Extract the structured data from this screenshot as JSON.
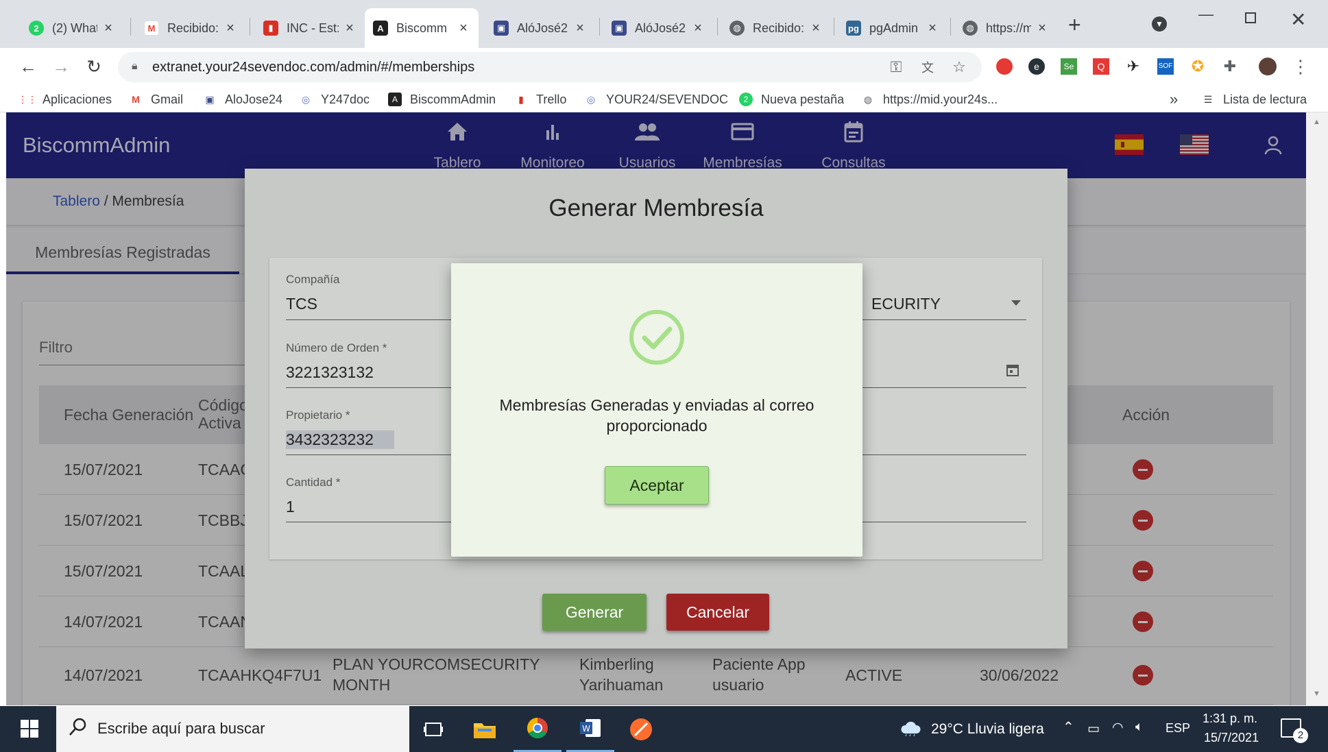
{
  "browser": {
    "tabs": [
      {
        "title": "(2) What:",
        "icon": "whatsapp-icon",
        "color": "#25d366"
      },
      {
        "title": "Recibido:",
        "icon": "gmail-icon",
        "color": "#ea4335"
      },
      {
        "title": "INC - Est:",
        "icon": "ticket-icon",
        "color": "#d93025"
      },
      {
        "title": "Biscomm",
        "icon": "angular-icon",
        "color": "#222222",
        "active": true
      },
      {
        "title": "AlóJosé2",
        "icon": "app-icon",
        "color": "#3a4a8a"
      },
      {
        "title": "AlóJosé2",
        "icon": "app-icon",
        "color": "#3a4a8a"
      },
      {
        "title": "Recibido:",
        "icon": "globe-icon",
        "color": "#5f6368"
      },
      {
        "title": "pgAdmin",
        "icon": "pgadmin-icon",
        "color": "#336791"
      },
      {
        "title": "https://m",
        "icon": "globe-icon",
        "color": "#5f6368"
      }
    ],
    "new_tab_label": "+",
    "url": "extranet.your24sevendoc.com/admin/#/memberships",
    "bookmarks": [
      {
        "label": "Aplicaciones",
        "icon": "apps-grid-icon"
      },
      {
        "label": "Gmail",
        "icon": "gmail-icon"
      },
      {
        "label": "AloJose24",
        "icon": "app-icon"
      },
      {
        "label": "Y247doc",
        "icon": "signal-icon"
      },
      {
        "label": "BiscommAdmin",
        "icon": "angular-icon"
      },
      {
        "label": "Trello",
        "icon": "trello-icon"
      },
      {
        "label": "YOUR24/SEVENDOC",
        "icon": "signal-icon"
      },
      {
        "label": "Nueva pestaña",
        "icon": "whatsapp-icon"
      },
      {
        "label": "https://mid.your24s...",
        "icon": "globe-icon"
      }
    ],
    "overflow_label": "»",
    "reading_list_label": "Lista de lectura"
  },
  "app": {
    "brand": "BiscommAdmin",
    "nav": [
      {
        "label": "Tablero",
        "icon": "home-icon"
      },
      {
        "label": "Monitoreo",
        "icon": "bar-chart-icon"
      },
      {
        "label": "Usuarios",
        "icon": "users-icon"
      },
      {
        "label": "Membresías",
        "icon": "credit-card-icon"
      },
      {
        "label": "Consultas",
        "icon": "calendar-icon"
      }
    ],
    "breadcrumb": {
      "root": "Tablero",
      "separator": " / ",
      "current": "Membresía"
    },
    "tab_label": "Membresías Registradas",
    "filter_placeholder": "Filtro",
    "table": {
      "headers": [
        "Fecha Generación",
        "Código\nActiva",
        "Acción"
      ],
      "rows": [
        {
          "fecha": "15/07/2021",
          "codigo": "TCAAC"
        },
        {
          "fecha": "15/07/2021",
          "codigo": "TCBBJ"
        },
        {
          "fecha": "15/07/2021",
          "codigo": "TCAAL"
        },
        {
          "fecha": "14/07/2021",
          "codigo": "TCAAN"
        },
        {
          "fecha": "14/07/2021",
          "codigo": "TCAAHKQ4F7U1",
          "plan": "PLAN YOURCOMSECURITY\nMONTH",
          "owner": "Kimberling\nYarihuaman",
          "type": "Paciente App\nusuario",
          "status": "ACTIVE",
          "expires": "30/06/2022"
        }
      ]
    }
  },
  "generate_modal": {
    "title": "Generar Membresía",
    "fields": {
      "company_label": "Compañía",
      "company_value": "TCS",
      "plan_value": "ECURITY",
      "order_label": "Número de Orden *",
      "order_value": "3221323132",
      "owner_label": "Propietario *",
      "owner_value": "3432323232",
      "qty_label": "Cantidad *",
      "qty_value": "1"
    },
    "generate_label": "Generar",
    "cancel_label": "Cancelar"
  },
  "success_modal": {
    "message": "Membresías Generadas y enviadas al correo proporcionado",
    "accept_label": "Aceptar",
    "accent": "#a8e08a"
  },
  "taskbar": {
    "search_placeholder": "Escribe aquí para buscar",
    "weather": "29°C  Lluvia ligera",
    "lang": "ESP",
    "time": "1:31 p. m.",
    "date": "15/7/2021",
    "notifications": "2"
  }
}
